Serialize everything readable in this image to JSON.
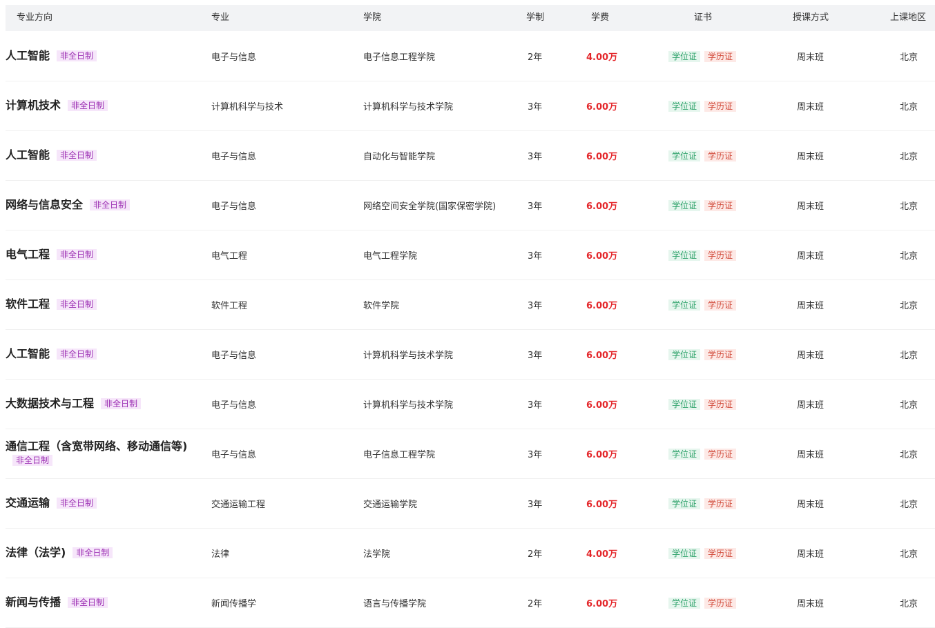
{
  "header": {
    "direction": "专业方向",
    "major": "专业",
    "college": "学院",
    "years": "学制",
    "fee": "学费",
    "certificate": "证书",
    "mode": "授课方式",
    "region": "上课地区"
  },
  "rows": [
    {
      "direction": "人工智能",
      "tag": "非全日制",
      "major": "电子与信息",
      "college": "电子信息工程学院",
      "years": "2年",
      "fee": "4.00万",
      "cert1": "学位证",
      "cert2": "学历证",
      "mode": "周末班",
      "region": "北京"
    },
    {
      "direction": "计算机技术",
      "tag": "非全日制",
      "major": "计算机科学与技术",
      "college": "计算机科学与技术学院",
      "years": "3年",
      "fee": "6.00万",
      "cert1": "学位证",
      "cert2": "学历证",
      "mode": "周末班",
      "region": "北京"
    },
    {
      "direction": "人工智能",
      "tag": "非全日制",
      "major": "电子与信息",
      "college": "自动化与智能学院",
      "years": "3年",
      "fee": "6.00万",
      "cert1": "学位证",
      "cert2": "学历证",
      "mode": "周末班",
      "region": "北京"
    },
    {
      "direction": "网络与信息安全",
      "tag": "非全日制",
      "major": "电子与信息",
      "college": "网络空间安全学院(国家保密学院)",
      "years": "3年",
      "fee": "6.00万",
      "cert1": "学位证",
      "cert2": "学历证",
      "mode": "周末班",
      "region": "北京"
    },
    {
      "direction": "电气工程",
      "tag": "非全日制",
      "major": "电气工程",
      "college": "电气工程学院",
      "years": "3年",
      "fee": "6.00万",
      "cert1": "学位证",
      "cert2": "学历证",
      "mode": "周末班",
      "region": "北京"
    },
    {
      "direction": "软件工程",
      "tag": "非全日制",
      "major": "软件工程",
      "college": "软件学院",
      "years": "3年",
      "fee": "6.00万",
      "cert1": "学位证",
      "cert2": "学历证",
      "mode": "周末班",
      "region": "北京"
    },
    {
      "direction": "人工智能",
      "tag": "非全日制",
      "major": "电子与信息",
      "college": "计算机科学与技术学院",
      "years": "3年",
      "fee": "6.00万",
      "cert1": "学位证",
      "cert2": "学历证",
      "mode": "周末班",
      "region": "北京"
    },
    {
      "direction": "大数据技术与工程",
      "tag": "非全日制",
      "major": "电子与信息",
      "college": "计算机科学与技术学院",
      "years": "3年",
      "fee": "6.00万",
      "cert1": "学位证",
      "cert2": "学历证",
      "mode": "周末班",
      "region": "北京"
    },
    {
      "direction": "通信工程（含宽带网络、移动通信等)",
      "tag": "非全日制",
      "major": "电子与信息",
      "college": "电子信息工程学院",
      "years": "3年",
      "fee": "6.00万",
      "cert1": "学位证",
      "cert2": "学历证",
      "mode": "周末班",
      "region": "北京"
    },
    {
      "direction": "交通运输",
      "tag": "非全日制",
      "major": "交通运输工程",
      "college": "交通运输学院",
      "years": "3年",
      "fee": "6.00万",
      "cert1": "学位证",
      "cert2": "学历证",
      "mode": "周末班",
      "region": "北京"
    },
    {
      "direction": "法律（法学)",
      "tag": "非全日制",
      "major": "法律",
      "college": "法学院",
      "years": "2年",
      "fee": "4.00万",
      "cert1": "学位证",
      "cert2": "学历证",
      "mode": "周末班",
      "region": "北京"
    },
    {
      "direction": "新闻与传播",
      "tag": "非全日制",
      "major": "新闻传播学",
      "college": "语言与传播学院",
      "years": "2年",
      "fee": "6.00万",
      "cert1": "学位证",
      "cert2": "学历证",
      "mode": "周末班",
      "region": "北京"
    }
  ]
}
